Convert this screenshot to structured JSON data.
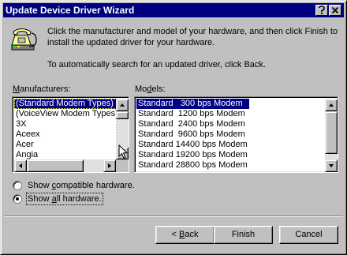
{
  "window": {
    "title": "Update Device Driver Wizard"
  },
  "intro": {
    "line1": "Click the manufacturer and model of your hardware, and then click Finish to install the updated driver for your hardware.",
    "line2": "To automatically search for an updated driver, click Back."
  },
  "manufacturers": {
    "label_mnemonic": "M",
    "label_rest": "anufacturers:",
    "items": [
      "(Standard Modem Types)",
      "(VoiceView Modem Types)",
      "3X",
      "Aceex",
      "Acer",
      "Angia"
    ],
    "selected_index": 0
  },
  "models": {
    "label_before": "Mo",
    "label_mnemonic": "d",
    "label_after": "els:",
    "items": [
      "Standard   300 bps Modem",
      "Standard  1200 bps Modem",
      "Standard  2400 bps Modem",
      "Standard  9600 bps Modem",
      "Standard 14400 bps Modem",
      "Standard 19200 bps Modem",
      "Standard 28800 bps Modem"
    ],
    "selected_index": 0
  },
  "options": {
    "compatible": {
      "before": "Show ",
      "mnemonic": "c",
      "after": "ompatible hardware.",
      "selected": false
    },
    "all": {
      "before": "Show ",
      "mnemonic": "a",
      "after": "ll hardware.",
      "selected": true
    }
  },
  "buttons": {
    "back": {
      "arrow": "< ",
      "mnemonic": "B",
      "rest": "ack"
    },
    "finish": "Finish",
    "cancel": "Cancel"
  },
  "icons": {
    "wizard": "telephone-modem-icon",
    "title_help": "help-icon",
    "title_close": "close-icon"
  },
  "colors": {
    "titlebar": "#000080",
    "selection": "#000080",
    "face": "#c0c0c0"
  }
}
